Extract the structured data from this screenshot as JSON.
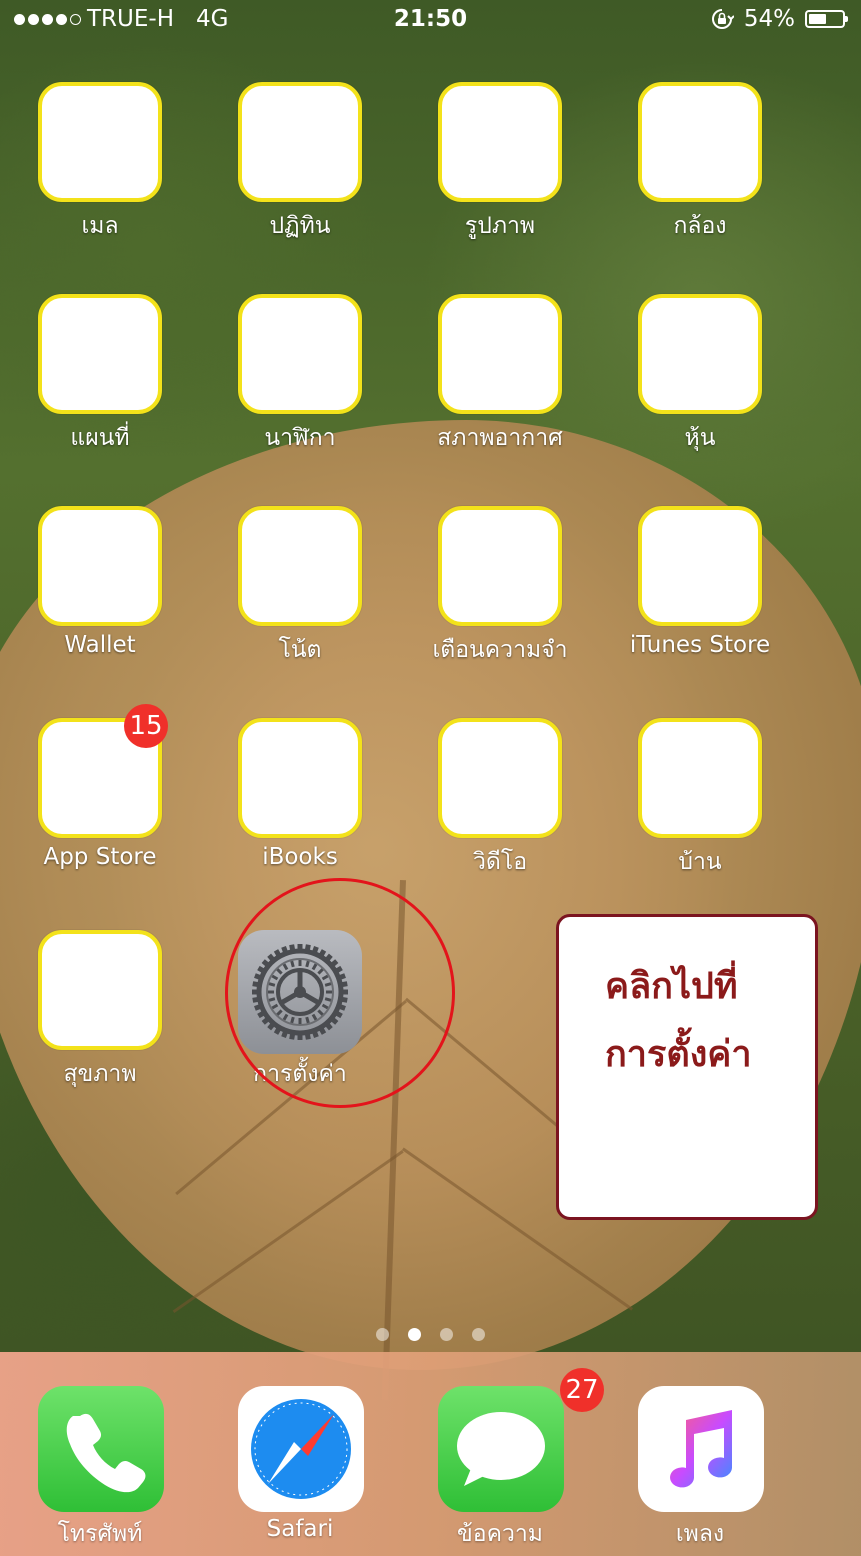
{
  "status_bar": {
    "carrier": "TRUE-H",
    "network": "4G",
    "time": "21:50",
    "battery_percent": "54%",
    "signal_bars": 4,
    "signal_total": 5,
    "battery_level": 0.54
  },
  "apps": [
    {
      "label": "เมล",
      "icon": "mail-icon"
    },
    {
      "label": "ปฏิทิน",
      "icon": "calendar-icon"
    },
    {
      "label": "รูปภาพ",
      "icon": "photos-icon"
    },
    {
      "label": "กล้อง",
      "icon": "camera-icon"
    },
    {
      "label": "แผนที่",
      "icon": "maps-icon"
    },
    {
      "label": "นาฬิกา",
      "icon": "clock-icon"
    },
    {
      "label": "สภาพอากาศ",
      "icon": "weather-icon"
    },
    {
      "label": "หุ้น",
      "icon": "stocks-icon"
    },
    {
      "label": "Wallet",
      "icon": "wallet-icon"
    },
    {
      "label": "โน้ต",
      "icon": "notes-icon"
    },
    {
      "label": "เตือนความจำ",
      "icon": "reminders-icon"
    },
    {
      "label": "iTunes Store",
      "icon": "itunes-icon"
    },
    {
      "label": "App Store",
      "icon": "appstore-icon",
      "badge": "15"
    },
    {
      "label": "iBooks",
      "icon": "ibooks-icon"
    },
    {
      "label": "วิดีโอ",
      "icon": "videos-icon"
    },
    {
      "label": "บ้าน",
      "icon": "home-icon"
    },
    {
      "label": "สุขภาพ",
      "icon": "health-icon"
    },
    {
      "label": "การตั้งค่า",
      "icon": "settings-gear-icon"
    }
  ],
  "callout": {
    "line1": "คลิกไปที่",
    "line2": "การตั้งค่า"
  },
  "page_indicator": {
    "pages": 4,
    "current": 2
  },
  "dock": [
    {
      "label": "โทรศัพท์",
      "icon": "phone-icon"
    },
    {
      "label": "Safari",
      "icon": "safari-compass-icon"
    },
    {
      "label": "ข้อความ",
      "icon": "messages-icon",
      "badge": "27"
    },
    {
      "label": "เพลง",
      "icon": "music-note-icon"
    }
  ],
  "colors": {
    "highlight_border": "#f3e21a",
    "annotation_red": "#e3141b",
    "callout_text": "#8b1a1a",
    "badge": "#f0302a"
  }
}
